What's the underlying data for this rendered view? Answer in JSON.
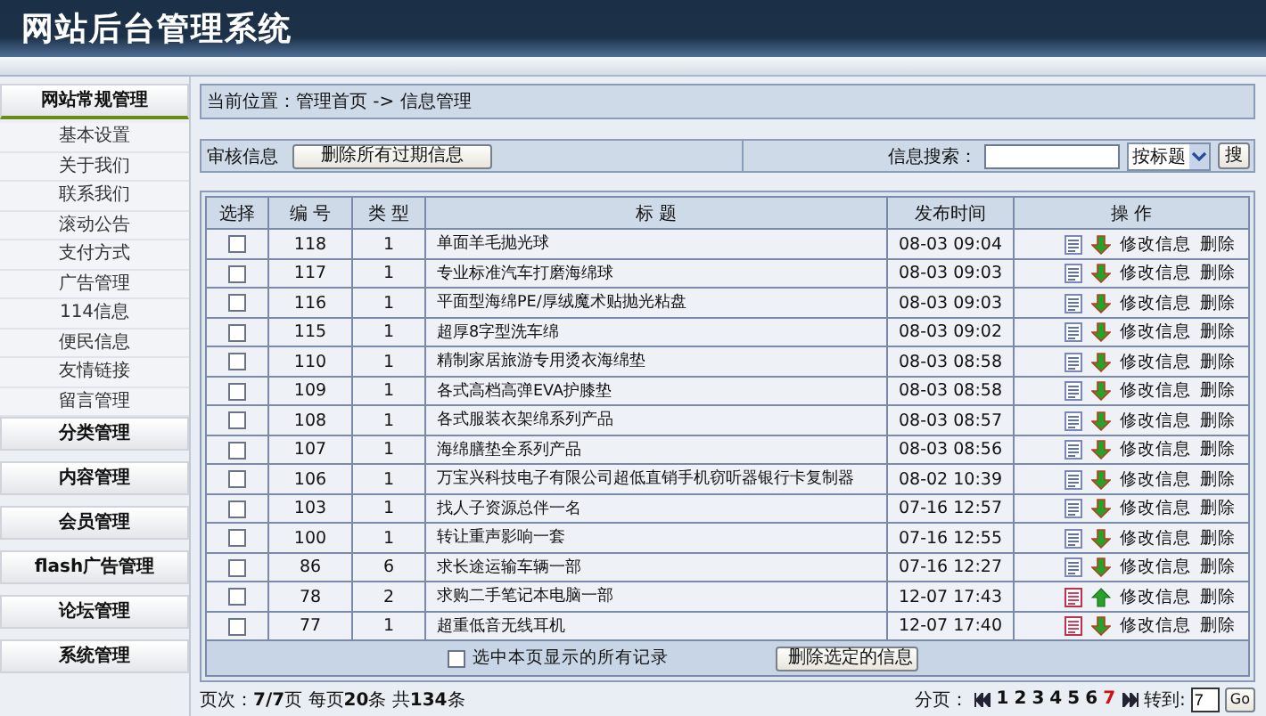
{
  "header": {
    "title": "网站后台管理系统"
  },
  "sidebar": {
    "groups": [
      {
        "label": "网站常规管理",
        "expanded": true,
        "children": [
          {
            "label": "基本设置"
          },
          {
            "label": "关于我们"
          },
          {
            "label": "联系我们"
          },
          {
            "label": "滚动公告"
          },
          {
            "label": "支付方式"
          },
          {
            "label": "广告管理"
          },
          {
            "label": "114信息"
          },
          {
            "label": "便民信息"
          },
          {
            "label": "友情链接"
          },
          {
            "label": "留言管理"
          }
        ]
      },
      {
        "label": "分类管理",
        "expanded": false
      },
      {
        "label": "内容管理",
        "expanded": false
      },
      {
        "label": "会员管理",
        "expanded": false
      },
      {
        "label": "flash广告管理",
        "expanded": false
      },
      {
        "label": "论坛管理",
        "expanded": false
      },
      {
        "label": "系统管理",
        "expanded": false
      }
    ]
  },
  "breadcrumb": "当前位置：管理首页 -> 信息管理",
  "toolbar": {
    "label": "审核信息",
    "delete_expired_button": "删除所有过期信息",
    "search_label": "信息搜索：",
    "search_select": "按标题",
    "search_button": "搜"
  },
  "table": {
    "columns": [
      "选择",
      "编 号",
      "类 型",
      "标 题",
      "发布时间",
      "操 作"
    ],
    "rows": [
      {
        "checked": false,
        "id": "118",
        "type": "1",
        "title": "单面羊毛抛光球",
        "time": "08-03 09:04",
        "doc_marked": false,
        "arrow_up": false,
        "edit": "修改信息",
        "delete": "删除"
      },
      {
        "checked": false,
        "id": "117",
        "type": "1",
        "title": "专业标准汽车打磨海绵球",
        "time": "08-03 09:03",
        "doc_marked": false,
        "arrow_up": false,
        "edit": "修改信息",
        "delete": "删除"
      },
      {
        "checked": false,
        "id": "116",
        "type": "1",
        "title": "平面型海绵PE/厚绒魔术贴抛光粘盘",
        "time": "08-03 09:03",
        "doc_marked": false,
        "arrow_up": false,
        "edit": "修改信息",
        "delete": "删除"
      },
      {
        "checked": false,
        "id": "115",
        "type": "1",
        "title": "超厚8字型洗车绵",
        "time": "08-03 09:02",
        "doc_marked": false,
        "arrow_up": false,
        "edit": "修改信息",
        "delete": "删除"
      },
      {
        "checked": false,
        "id": "110",
        "type": "1",
        "title": "精制家居旅游专用烫衣海绵垫",
        "time": "08-03 08:58",
        "doc_marked": false,
        "arrow_up": false,
        "edit": "修改信息",
        "delete": "删除"
      },
      {
        "checked": false,
        "id": "109",
        "type": "1",
        "title": "各式高档高弹EVA护膝垫",
        "time": "08-03 08:58",
        "doc_marked": false,
        "arrow_up": false,
        "edit": "修改信息",
        "delete": "删除"
      },
      {
        "checked": false,
        "id": "108",
        "type": "1",
        "title": "各式服装衣架绵系列产品",
        "time": "08-03 08:57",
        "doc_marked": false,
        "arrow_up": false,
        "edit": "修改信息",
        "delete": "删除"
      },
      {
        "checked": false,
        "id": "107",
        "type": "1",
        "title": "海绵膳垫全系列产品",
        "time": "08-03 08:56",
        "doc_marked": false,
        "arrow_up": false,
        "edit": "修改信息",
        "delete": "删除"
      },
      {
        "checked": false,
        "id": "106",
        "type": "1",
        "title": "万宝兴科技电子有限公司超低直销手机窃听器银行卡复制器",
        "time": "08-02 10:39",
        "doc_marked": false,
        "arrow_up": false,
        "edit": "修改信息",
        "delete": "删除"
      },
      {
        "checked": false,
        "id": "103",
        "type": "1",
        "title": "找人子资源总伴一名",
        "time": "07-16 12:57",
        "doc_marked": false,
        "arrow_up": false,
        "edit": "修改信息",
        "delete": "删除"
      },
      {
        "checked": false,
        "id": "100",
        "type": "1",
        "title": "转让重声影响一套",
        "time": "07-16 12:55",
        "doc_marked": false,
        "arrow_up": false,
        "edit": "修改信息",
        "delete": "删除"
      },
      {
        "checked": false,
        "id": "86",
        "type": "6",
        "title": "求长途运输车辆一部",
        "time": "07-16 12:27",
        "doc_marked": false,
        "arrow_up": false,
        "edit": "修改信息",
        "delete": "删除"
      },
      {
        "checked": false,
        "id": "78",
        "type": "2",
        "title": "求购二手笔记本电脑一部",
        "time": "12-07 17:43",
        "doc_marked": true,
        "arrow_up": true,
        "edit": "修改信息",
        "delete": "删除"
      },
      {
        "checked": false,
        "id": "77",
        "type": "1",
        "title": "超重低音无线耳机",
        "time": "12-07 17:40",
        "doc_marked": true,
        "arrow_up": false,
        "edit": "修改信息",
        "delete": "删除"
      }
    ],
    "select_all": {
      "label": "选中本页显示的所有记录",
      "checked": false
    },
    "delete_selected_button": "删除选定的信息"
  },
  "footer": {
    "summary": "页次：**7/7**页 每页**20**条 共**134**条",
    "pager_label": "分页：",
    "pages": [
      {
        "label": "1",
        "selected": false
      },
      {
        "label": "2",
        "selected": false
      },
      {
        "label": "3",
        "selected": false
      },
      {
        "label": "4",
        "selected": false
      },
      {
        "label": "5",
        "selected": false
      },
      {
        "label": "6",
        "selected": false
      },
      {
        "label": "7",
        "selected": true
      }
    ],
    "goto_label": "转到:",
    "goto_value": "7",
    "go_button": "Go"
  }
}
